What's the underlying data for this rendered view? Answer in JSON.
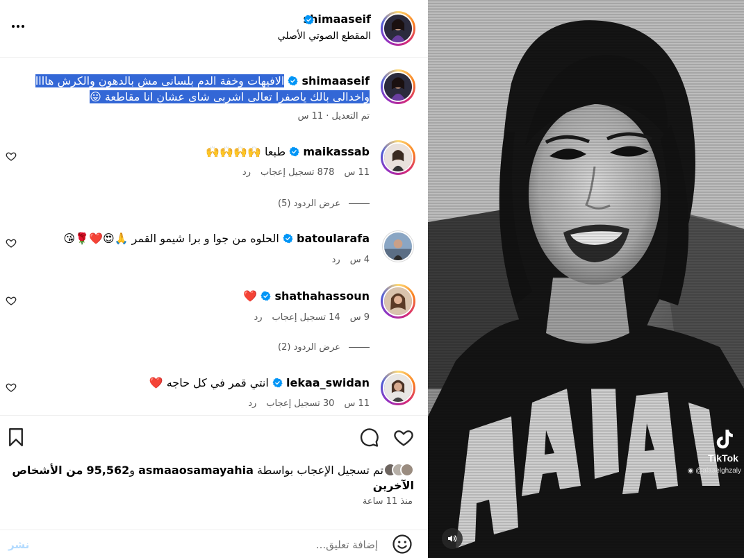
{
  "post": {
    "author": "shimaaseif",
    "audio_label": "المقطع الصوتي الأصلي",
    "caption_line1": "الافيهات وخفة الدم بلسانى مش بالدهون والكرش هاااا",
    "caption_line2": "واخدالى بالك ياصفرا تعالى اشربى شاى عشان انا مقاطعة",
    "caption_meta": "تم التعديل · 11 س"
  },
  "comments": [
    {
      "username": "maikassab",
      "text": "طبعا 🙌🙌🙌🙌",
      "time": "11 س",
      "likes": "878 تسجيل إعجاب",
      "reply": "رد",
      "view_replies": "عرض الردود (5)"
    },
    {
      "username": "batoularafa",
      "text": "الحلوه من جوا و برا شيمو القمر 🙏😍❤️🌹😘",
      "time": "4 س",
      "reply": "رد"
    },
    {
      "username": "shathahassoun",
      "text": "❤️",
      "time": "9 س",
      "likes": "14 تسجيل إعجاب",
      "reply": "رد",
      "view_replies": "عرض الردود (2)"
    },
    {
      "username": "lekaa_swidan",
      "text": "انتي قمر في كل حاجه ❤️",
      "time": "11 س",
      "likes": "30 تسجيل إعجاب",
      "reply": "رد"
    }
  ],
  "likes_summary": {
    "prefix": "تم تسجيل الإعجاب بواسطة",
    "user": "asmaaosamayahia",
    "conj": "و",
    "count": "95,562",
    "suffix": "من الأشخاص الآخرين"
  },
  "posted_time": "منذ 11 ساعة",
  "add_comment": {
    "placeholder": "إضافة تعليق...",
    "post_label": "نشر"
  },
  "video": {
    "brand": "TikTok",
    "handle": "@alaaelghzaly"
  },
  "colors": {
    "verified": "#0095f6",
    "selection": "#3367d6",
    "post_disabled": "#b3dbff"
  }
}
